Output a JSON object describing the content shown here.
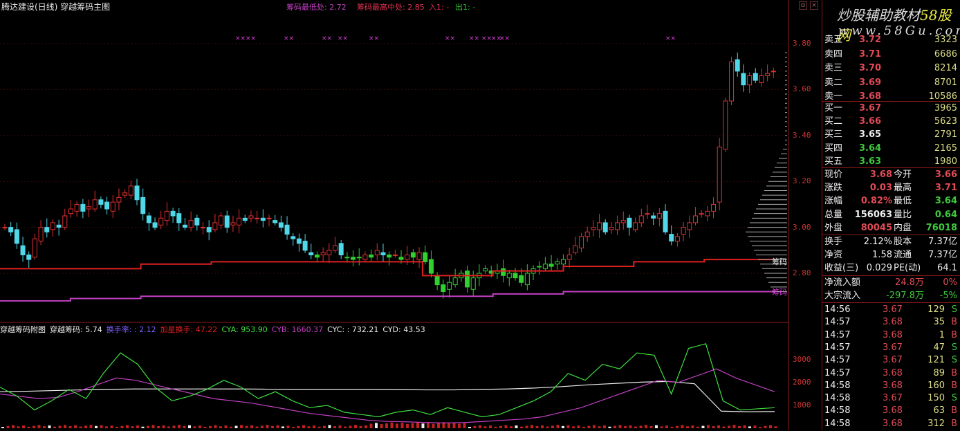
{
  "header": {
    "title": "腾达建设(日线) 穿越筹码主图",
    "ind": [
      {
        "label": "筹码最低处: 2.72",
        "color": "#c040c0"
      },
      {
        "label": "筹码最高中处: 2.85",
        "color": "#e03050"
      },
      {
        "label": "入1: -",
        "color": "#e03050"
      },
      {
        "label": "出1: -",
        "color": "#30c030"
      }
    ]
  },
  "sub_header": [
    {
      "label": "穿越筹码附图",
      "color": "#eee"
    },
    {
      "label": "穿越筹码: 5.74",
      "color": "#eee"
    },
    {
      "label": "换手率: : 2.12",
      "color": "#8060ff"
    },
    {
      "label": "加星换手: 47.22",
      "color": "#e02020"
    },
    {
      "label": "CYA: 953.90",
      "color": "#40e040"
    },
    {
      "label": "CYB: 1660.37",
      "color": "#c040c0"
    },
    {
      "label": "CYC: : 732.21",
      "color": "#eee"
    },
    {
      "label": "CYD: 43.53",
      "color": "#eee"
    }
  ],
  "price_axis": [
    "3.80",
    "3.60",
    "3.40",
    "3.20",
    "3.00",
    "2.80"
  ],
  "vol_axis": [
    "3000",
    "2000",
    "1000"
  ],
  "chip_labels": [
    "筹码",
    "筹码"
  ],
  "logo": {
    "cn": "炒股辅助教材",
    "brand": "58股网",
    "url": "www.58Gu.com"
  },
  "quote": {
    "asks": [
      {
        "l": "卖五",
        "p": "3.72",
        "v": "3323"
      },
      {
        "l": "卖四",
        "p": "3.71",
        "v": "6686"
      },
      {
        "l": "卖三",
        "p": "3.70",
        "v": "8214"
      },
      {
        "l": "卖二",
        "p": "3.69",
        "v": "8701"
      },
      {
        "l": "卖一",
        "p": "3.68",
        "v": "10586"
      }
    ],
    "bids": [
      {
        "l": "买一",
        "p": "3.67",
        "v": "3965",
        "c": "r"
      },
      {
        "l": "买二",
        "p": "3.66",
        "v": "5623",
        "c": "r"
      },
      {
        "l": "买三",
        "p": "3.65",
        "v": "2791",
        "c": "w"
      },
      {
        "l": "买四",
        "p": "3.64",
        "v": "2165",
        "c": "g"
      },
      {
        "l": "买五",
        "p": "3.63",
        "v": "1980",
        "c": "g"
      }
    ],
    "stats": [
      {
        "a": "现价",
        "av": "3.68",
        "ac": "r",
        "b": "今开",
        "bv": "3.66",
        "bc": "r"
      },
      {
        "a": "涨跌",
        "av": "0.03",
        "ac": "r",
        "b": "最高",
        "bv": "3.71",
        "bc": "r"
      },
      {
        "a": "涨幅",
        "av": "0.82%",
        "ac": "r",
        "b": "最低",
        "bv": "3.64",
        "bc": "g"
      },
      {
        "a": "总量",
        "av": "156063",
        "ac": "w",
        "b": "量比",
        "bv": "0.64",
        "bc": "g"
      },
      {
        "a": "外盘",
        "av": "80045",
        "ac": "r",
        "b": "内盘",
        "bv": "76018",
        "bc": "g"
      }
    ],
    "stats2": [
      {
        "a": "换手",
        "av": "2.12%",
        "ac": "w",
        "b": "股本",
        "bv": "7.37亿",
        "bc": "w"
      },
      {
        "a": "净资",
        "av": "1.58",
        "ac": "w",
        "b": "流通",
        "bv": "7.37亿",
        "bc": "w"
      },
      {
        "a": "收益(三)",
        "av": "0.029",
        "ac": "w",
        "b": "PE(动)",
        "bv": "64.1",
        "bc": "w"
      }
    ],
    "flows": [
      {
        "l": "净流入额",
        "v": "24.8万",
        "p": "0%",
        "c": "r"
      },
      {
        "l": "大宗流入",
        "v": "-297.8万",
        "p": "-5%",
        "c": "g"
      }
    ],
    "ticks": [
      [
        "14:56",
        "3.67",
        "129",
        "S"
      ],
      [
        "14:57",
        "3.68",
        "35",
        "B"
      ],
      [
        "14:57",
        "3.68",
        "1",
        "B"
      ],
      [
        "14:57",
        "3.67",
        "47",
        "S"
      ],
      [
        "14:57",
        "3.67",
        "121",
        "S"
      ],
      [
        "14:57",
        "3.68",
        "89",
        "B"
      ],
      [
        "14:58",
        "3.68",
        "160",
        "B"
      ],
      [
        "14:58",
        "3.67",
        "150",
        "S"
      ],
      [
        "14:58",
        "3.68",
        "63",
        "B"
      ],
      [
        "14:58",
        "3.68",
        "312",
        "B"
      ]
    ]
  },
  "chart_data": {
    "type": "candlestick",
    "closes": [
      3.0,
      2.98,
      2.93,
      2.88,
      2.86,
      2.95,
      3.0,
      2.98,
      3.02,
      3.0,
      3.05,
      3.08,
      3.1,
      3.07,
      3.09,
      3.12,
      3.1,
      3.08,
      3.11,
      3.13,
      3.15,
      3.18,
      3.12,
      3.06,
      3.02,
      3.0,
      3.04,
      3.07,
      3.05,
      3.02,
      3.0,
      3.03,
      3.01,
      3.0,
      2.98,
      3.02,
      3.05,
      3.0,
      3.02,
      3.04,
      3.03,
      3.05,
      3.04,
      3.03,
      3.04,
      3.02,
      3.0,
      2.97,
      2.95,
      2.93,
      2.9,
      2.88,
      2.87,
      2.89,
      2.9,
      2.92,
      2.88,
      2.87,
      2.86,
      2.87,
      2.88,
      2.87,
      2.9,
      2.88,
      2.87,
      2.88,
      2.86,
      2.88,
      2.87,
      2.89,
      2.85,
      2.8,
      2.75,
      2.72,
      2.76,
      2.78,
      2.8,
      2.74,
      2.78,
      2.8,
      2.82,
      2.8,
      2.81,
      2.79,
      2.8,
      2.78,
      2.76,
      2.8,
      2.82,
      2.83,
      2.84,
      2.83,
      2.85,
      2.86,
      2.88,
      2.92,
      2.96,
      2.98,
      3.0,
      3.02,
      2.98,
      3.0,
      3.02,
      3.03,
      3.0,
      3.02,
      3.05,
      3.06,
      3.04,
      3.06,
      2.98,
      2.94,
      2.96,
      3.0,
      3.02,
      3.05,
      3.06,
      3.07,
      3.1,
      3.35,
      3.55,
      3.72,
      3.68,
      3.62,
      3.66,
      3.64,
      3.66,
      3.67,
      3.68
    ],
    "chip_high": [
      2.82,
      2.82,
      2.84,
      2.85,
      2.85,
      2.85,
      2.79,
      2.81,
      2.83,
      2.85,
      2.86
    ],
    "chip_low": [
      2.68,
      2.69,
      2.7,
      2.7,
      2.7,
      2.7,
      2.7,
      2.71,
      2.72,
      2.72,
      2.72
    ],
    "cya": [
      1800,
      1400,
      800,
      1200,
      1700,
      1300,
      2400,
      3300,
      2800,
      1800,
      1200,
      1400,
      1700,
      2100,
      1800,
      1300,
      1600,
      1200,
      900,
      1000,
      700,
      600,
      500,
      700,
      800,
      600,
      900,
      700,
      500,
      600,
      900,
      1200,
      1600,
      2400,
      2100,
      2800,
      2600,
      3300,
      3200,
      1500,
      3500,
      3700,
      1200,
      800,
      850,
      900
    ],
    "cyb": [
      1500,
      1400,
      1300,
      1350,
      1600,
      1900,
      2200,
      2100,
      1900,
      1700,
      1500,
      1300,
      1200,
      1100,
      950,
      800,
      650,
      550,
      450,
      350,
      300,
      280,
      250,
      230,
      250,
      300,
      350,
      400,
      500,
      700,
      900,
      1200,
      1500,
      1800,
      2100,
      2000,
      2300,
      2600,
      2200,
      1900,
      1600
    ],
    "cyc": [
      1600,
      1620,
      1650,
      1680,
      1700,
      1720,
      1720,
      1720,
      1720,
      1720,
      1710,
      1700,
      1700,
      1700,
      1700,
      1690,
      1680,
      1680,
      1700,
      1720,
      1760,
      1820,
      1900,
      1960,
      2020,
      2050,
      1950,
      750,
      720,
      730
    ],
    "ylim": [
      2.7,
      3.8
    ]
  }
}
